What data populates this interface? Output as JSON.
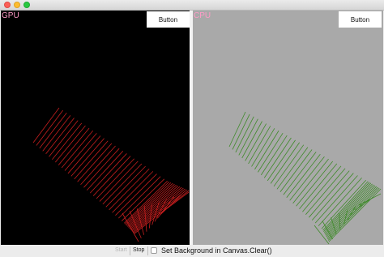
{
  "window": {
    "controls": [
      "close",
      "minimize",
      "maximize"
    ]
  },
  "gpu_panel": {
    "label": "GPU",
    "button_label": "Button",
    "background": "#000000",
    "stroke": "#c41e1e"
  },
  "cpu_panel": {
    "label": "CPU",
    "button_label": "Button",
    "background": "#a9a9a9",
    "stroke": "#3f8a2a"
  },
  "toolbar": {
    "start_label": "Start",
    "stop_label": "Stop",
    "checkbox_label": "Set Background in Canvas.Clear()",
    "checkbox_checked": false
  }
}
